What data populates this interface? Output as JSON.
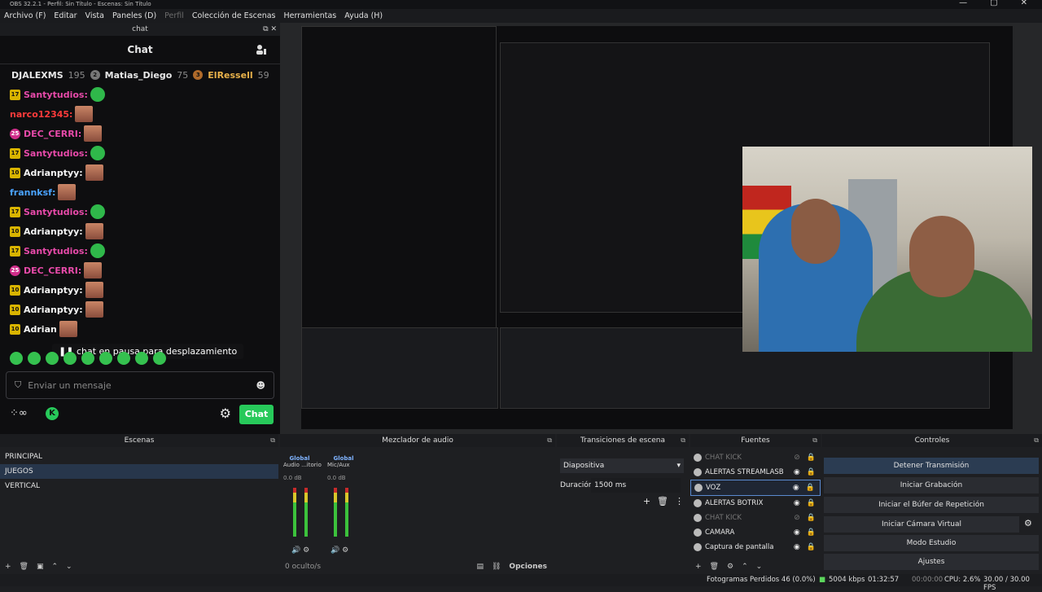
{
  "window": {
    "title": "OBS 32.2.1 - Perfil: Sin Título - Escenas: Sin Título"
  },
  "menu": {
    "items": [
      "Archivo (F)",
      "Editar",
      "Vista",
      "Paneles (D)",
      "Perfil",
      "Colección de Escenas",
      "Herramientas",
      "Ayuda (H)"
    ]
  },
  "chat_dock": {
    "dock_title": "chat",
    "header": "Chat",
    "leaderboard": [
      {
        "name": "DJALEXMS",
        "count": "195",
        "rank": ""
      },
      {
        "name": "Matias_Diego",
        "count": "75",
        "rank": "2"
      },
      {
        "name": "ElRessell",
        "count": "59",
        "rank": "3"
      }
    ],
    "messages": [
      {
        "level": "17",
        "user": "Santytudios:",
        "color": "#e74aa9"
      },
      {
        "level": "",
        "user": "narco12345:",
        "color": "#ff3b3b"
      },
      {
        "level": "25",
        "user": "DEC_CERRI:",
        "color": "#e74aa9"
      },
      {
        "level": "17",
        "user": "Santytudios:",
        "color": "#e74aa9"
      },
      {
        "level": "10",
        "user": "Adrianptyy:",
        "color": "#f5f5f5"
      },
      {
        "level": "",
        "user": "frannksf:",
        "color": "#4aa3ff"
      },
      {
        "level": "17",
        "user": "Santytudios:",
        "color": "#e74aa9"
      },
      {
        "level": "10",
        "user": "Adrianptyy:",
        "color": "#f5f5f5"
      },
      {
        "level": "17",
        "user": "Santytudios:",
        "color": "#e74aa9"
      },
      {
        "level": "25",
        "user": "DEC_CERRI:",
        "color": "#e74aa9"
      },
      {
        "level": "10",
        "user": "Adrianptyy:",
        "color": "#f5f5f5"
      },
      {
        "level": "10",
        "user": "Adrianptyy:",
        "color": "#f5f5f5"
      },
      {
        "level": "10",
        "user": "Adrian",
        "color": "#f5f5f5"
      }
    ],
    "pause_text": "chat en pausa para desplazamiento",
    "input_placeholder": "Enviar un mensaje",
    "chat_button": "Chat"
  },
  "scenes": {
    "title": "Escenas",
    "items": [
      "PRINCIPAL",
      "JUEGOS",
      "VERTICAL"
    ],
    "selected": "JUEGOS"
  },
  "mixer": {
    "title": "Mezclador de audio",
    "channels": [
      {
        "name": "Global",
        "sub": "Audio ...itorio",
        "db": "0.0 dB",
        "level": 0.75
      },
      {
        "name": "Global",
        "sub": "Mic/Aux",
        "db": "0.0 dB",
        "level": 0.7
      }
    ],
    "hidden": "0 oculto/s",
    "options": "Opciones"
  },
  "transitions": {
    "title": "Transiciones de escena",
    "type": "Diapositiva",
    "duration_label": "Duración",
    "duration_value": "1500 ms"
  },
  "sources": {
    "title": "Fuentes",
    "items": [
      {
        "name": "CHAT KICK",
        "dim": true
      },
      {
        "name": "ALERTAS STREAMLASB",
        "dim": false
      },
      {
        "name": "VOZ",
        "dim": false,
        "selected": true
      },
      {
        "name": "ALERTAS BOTRIX",
        "dim": false
      },
      {
        "name": "CHAT KICK",
        "dim": true
      },
      {
        "name": "CAMARA",
        "dim": false
      },
      {
        "name": "Captura de pantalla",
        "dim": false
      }
    ]
  },
  "controls": {
    "title": "Controles",
    "buttons": [
      "Detener Transmisión",
      "Iniciar Grabación",
      "Iniciar el Búfer de Repetición",
      "Iniciar Cámara Virtual",
      "Modo Estudio",
      "Ajustes"
    ]
  },
  "status": {
    "dropped": "Fotogramas Perdidos 46 (0.0%)",
    "kbps": "5004 kbps",
    "stream_time": "01:32:57",
    "rec_time": "00:00:00",
    "cpu": "CPU: 2.6%",
    "fps": "30.00 / 30.00 FPS"
  }
}
